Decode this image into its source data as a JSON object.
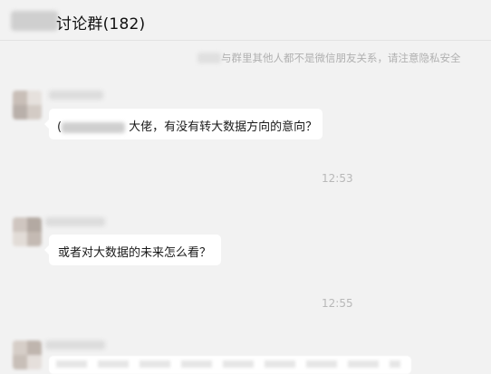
{
  "header": {
    "title_suffix": "讨论群(182)"
  },
  "system_notice": {
    "text": "与群里其他人都不是微信朋友关系，请注意隐私安全"
  },
  "messages": [
    {
      "text": "大佬，有没有转大数据方向的意向？",
      "has_mention": true,
      "mention_prefix": "("
    },
    {
      "text": "或者对大数据的未来怎么看？",
      "has_mention": false
    }
  ],
  "timestamps": [
    "12:53",
    "12:55"
  ],
  "colors": {
    "background": "#f2f2f2",
    "bubble": "#ffffff",
    "meta_text": "#b8b8b8"
  }
}
